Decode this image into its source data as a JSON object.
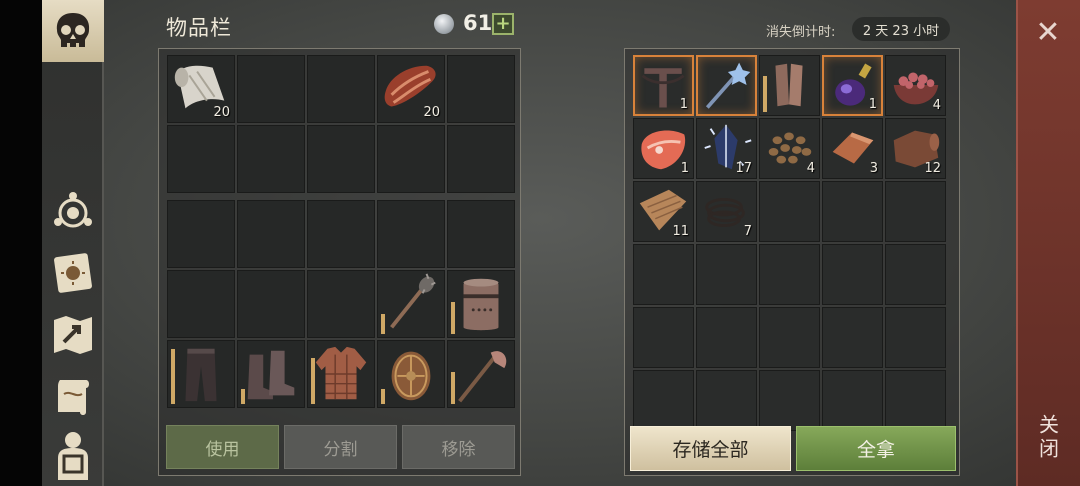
{
  "inventory": {
    "title": "物品栏",
    "currency_icon": "silver-coin-icon",
    "currency_amount": "61",
    "add_currency_label": "+",
    "top_slots": [
      {
        "icon": "cloth-roll-icon",
        "qty": "20"
      },
      {
        "icon": "",
        "qty": ""
      },
      {
        "icon": "",
        "qty": ""
      },
      {
        "icon": "raw-meat-icon",
        "qty": "20"
      },
      {
        "icon": "",
        "qty": ""
      },
      {
        "icon": "",
        "qty": ""
      },
      {
        "icon": "",
        "qty": ""
      },
      {
        "icon": "",
        "qty": ""
      },
      {
        "icon": "",
        "qty": ""
      },
      {
        "icon": "",
        "qty": ""
      }
    ],
    "equipment_slots": [
      {
        "icon": "",
        "durability": 0
      },
      {
        "icon": "",
        "durability": 0
      },
      {
        "icon": "",
        "durability": 0
      },
      {
        "icon": "",
        "durability": 0
      },
      {
        "icon": "",
        "durability": 0
      },
      {
        "icon": "",
        "durability": 0
      },
      {
        "icon": "",
        "durability": 0
      },
      {
        "icon": "",
        "durability": 0
      },
      {
        "icon": "mace-icon",
        "durability": 0.35
      },
      {
        "icon": "knight-helmet-icon",
        "durability": 0.55
      },
      {
        "icon": "leather-pants-icon",
        "durability": 0.95
      },
      {
        "icon": "boots-icon",
        "durability": 0.25
      },
      {
        "icon": "padded-armor-icon",
        "durability": 0.8
      },
      {
        "icon": "round-shield-icon",
        "durability": 0.25
      },
      {
        "icon": "battle-axe-icon",
        "durability": 0.55
      }
    ],
    "buttons": {
      "use": "使用",
      "split": "分割",
      "remove": "移除"
    }
  },
  "storage": {
    "countdown_label": "消失倒计时:",
    "countdown_value": "2 天 23 小时",
    "slots": [
      {
        "icon": "crossbow-icon",
        "qty": "1",
        "highlight": true
      },
      {
        "icon": "ice-mace-icon",
        "qty": "",
        "highlight": true
      },
      {
        "icon": "gloves-icon",
        "qty": "",
        "highlight": false,
        "durability": 0.7
      },
      {
        "icon": "potion-icon",
        "qty": "1",
        "highlight": true
      },
      {
        "icon": "berries-bowl-icon",
        "qty": "4",
        "highlight": false
      },
      {
        "icon": "fish-steak-icon",
        "qty": "1",
        "highlight": false
      },
      {
        "icon": "crystal-shard-icon",
        "qty": "17",
        "highlight": false
      },
      {
        "icon": "seeds-icon",
        "qty": "4",
        "highlight": false
      },
      {
        "icon": "copper-ingot-icon",
        "qty": "3",
        "highlight": false
      },
      {
        "icon": "leather-icon",
        "qty": "12",
        "highlight": false
      },
      {
        "icon": "fabric-icon",
        "qty": "11",
        "highlight": false
      },
      {
        "icon": "rope-icon",
        "qty": "7",
        "highlight": false
      }
    ],
    "buttons": {
      "store_all": "存储全部",
      "take_all": "全拿"
    }
  },
  "close": {
    "icon": "close-icon",
    "label": "关闭"
  },
  "sidebar": {
    "active_tab_icon": "skull-icon",
    "items": [
      "crafting-icon",
      "journal-icon",
      "map-icon",
      "scroll-icon",
      "character-icon"
    ]
  }
}
